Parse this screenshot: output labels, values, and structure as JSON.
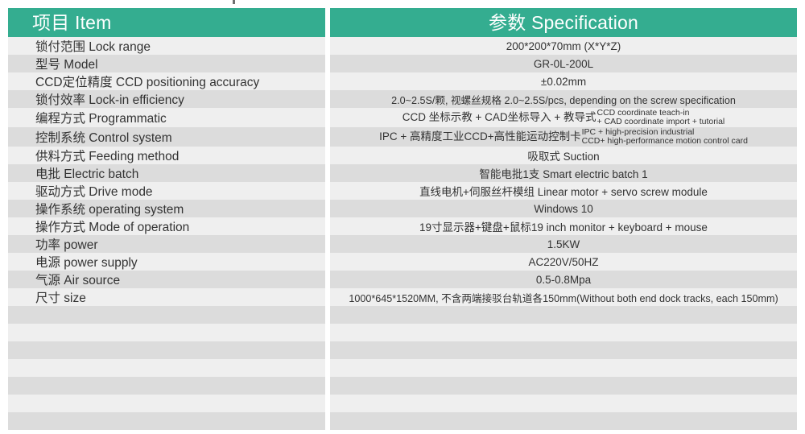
{
  "table": {
    "headers": {
      "item": "项目 Item",
      "spec": "参数 Specification"
    },
    "accent_color": "#34ad90",
    "header_text_color": "#ffffff",
    "row_color_odd": "#efefef",
    "row_color_even": "#dcdcdc",
    "rows": [
      {
        "item": "锁付范围 Lock range",
        "spec": "200*200*70mm (X*Y*Z)"
      },
      {
        "item": "型号  Model",
        "spec": "GR-0L-200L"
      },
      {
        "item": "CCD定位精度 CCD positioning accuracy",
        "spec": "±0.02mm"
      },
      {
        "item": "锁付效率 Lock-in efficiency",
        "spec": "2.0~2.5S/颗, 视螺丝规格 2.0~2.5S/pcs, depending on the screw specification"
      },
      {
        "item": "编程方式  Programmatic",
        "spec_cn": "CCD 坐标示教 + CAD坐标导入 + 教导式",
        "spec_en_line1": "CCD coordinate teach-in",
        "spec_en_line2": "+ CAD coordinate import + tutorial"
      },
      {
        "item": "控制系统 Control system",
        "spec_cn": "IPC + 高精度工业CCD+高性能运动控制卡",
        "spec_en_line1": "IPC + high-precision industrial",
        "spec_en_line2": "CCD+ high-performance motion control card"
      },
      {
        "item": "供料方式 Feeding method",
        "spec": "吸取式 Suction"
      },
      {
        "item": "电批 Electric batch",
        "spec": "智能电批1支 Smart electric batch 1"
      },
      {
        "item": "驱动方式 Drive mode",
        "spec": "直线电机+伺服丝杆模组 Linear motor + servo screw module"
      },
      {
        "item": "操作系统 operating system",
        "spec": "Windows 10"
      },
      {
        "item": "操作方式 Mode of operation",
        "spec": "19寸显示器+键盘+鼠标19 inch monitor + keyboard + mouse"
      },
      {
        "item": "功率 power",
        "spec": "1.5KW"
      },
      {
        "item": "电源 power supply",
        "spec": "AC220V/50HZ"
      },
      {
        "item": "气源 Air source",
        "spec": "0.5-0.8Mpa"
      },
      {
        "item": "尺寸 size",
        "spec": "1000*645*1520MM, 不含两端接驳台轨道各150mm(Without both end dock tracks, each 150mm)"
      }
    ],
    "empty_row_count": 7
  }
}
